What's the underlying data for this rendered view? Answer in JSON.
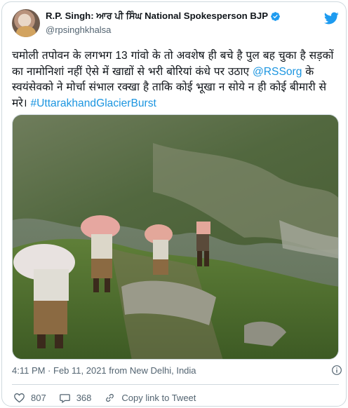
{
  "author": {
    "display_name": "R.P. Singh: ਆਰ ਪੀ ਸਿੰਘ National Spokesperson BJP",
    "handle": "@rpsinghkhalsa"
  },
  "tweet": {
    "text_part1": "चमोली तपोवन के लगभग 13 गांवो के तो अवशेष ही बचे है पुल बह चुका है सड़कों का नामोनिशां नहीं ऐसे में खाद्यों से भरी बोरियां कंधे पर उठाए ",
    "mention": "@RSSorg",
    "text_part2": " के स्वयंसेवको ने मोर्चा संभाल रक्खा है ताकि कोई भूखा न सोये न ही कोई बीमारी से मरे। ",
    "hashtag": "#UttarakhandGlacierBurst"
  },
  "meta": {
    "timestamp": "4:11 PM · Feb 11, 2021 from New Delhi, India"
  },
  "actions": {
    "like_count": "807",
    "reply_count": "368",
    "copy_link_label": "Copy link to Tweet"
  },
  "colors": {
    "link": "#1b95e0",
    "twitter_blue": "#1d9bf0",
    "secondary_text": "#536471"
  },
  "icons": [
    "verified-badge-icon",
    "twitter-bird-icon",
    "info-icon",
    "heart-icon",
    "comment-icon",
    "link-icon"
  ]
}
